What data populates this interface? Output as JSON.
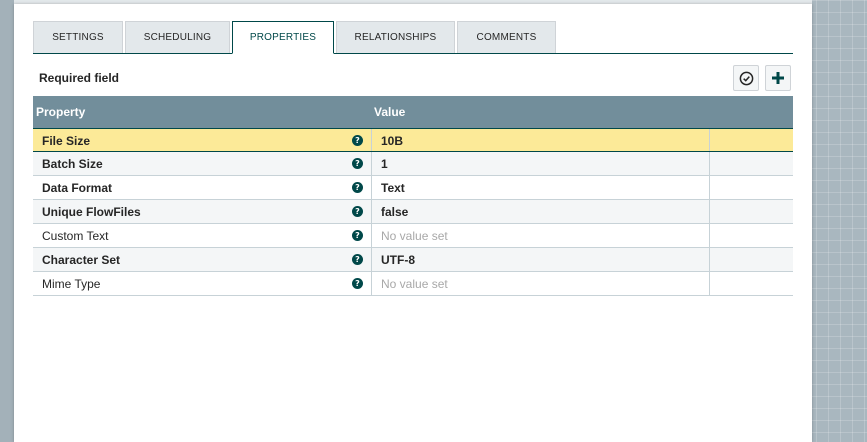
{
  "tabs": [
    {
      "label": "SETTINGS"
    },
    {
      "label": "SCHEDULING"
    },
    {
      "label": "PROPERTIES"
    },
    {
      "label": "RELATIONSHIPS"
    },
    {
      "label": "COMMENTS"
    }
  ],
  "active_tab": "PROPERTIES",
  "required_label": "Required field",
  "toolbar": {
    "verify_icon": "check-circle-icon",
    "add_icon": "plus-icon"
  },
  "table": {
    "headers": {
      "property": "Property",
      "value": "Value"
    },
    "rows": [
      {
        "name": "File Size",
        "value": "10B",
        "required": true
      },
      {
        "name": "Batch Size",
        "value": "1",
        "required": true
      },
      {
        "name": "Data Format",
        "value": "Text",
        "required": true
      },
      {
        "name": "Unique FlowFiles",
        "value": "false",
        "required": true
      },
      {
        "name": "Custom Text",
        "value": "No value set",
        "required": false
      },
      {
        "name": "Character Set",
        "value": "UTF-8",
        "required": true
      },
      {
        "name": "Mime Type",
        "value": "No value set",
        "required": false
      }
    ]
  },
  "colors": {
    "accent": "#004849",
    "header_bg": "#728e9b",
    "selected_row": "#fcea98"
  }
}
